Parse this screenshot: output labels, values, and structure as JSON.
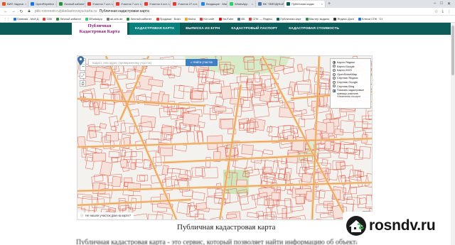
{
  "browser": {
    "tabs": [
      {
        "label": "ВИП Задачи",
        "color": "#e8531a"
      },
      {
        "label": "OpenRepetitor",
        "color": "#1a73e8"
      },
      {
        "label": "Личный кабинет",
        "color": "#2a8f3a"
      },
      {
        "label": "Участок 7 сот. Ц",
        "color": "#e53935"
      },
      {
        "label": "Участок 7 сот. Ц",
        "color": "#e53935"
      },
      {
        "label": "Участок 4 сот. Ц",
        "color": "#e53935"
      },
      {
        "label": "Участок 27 сот.",
        "color": "#e53935"
      },
      {
        "label": "Входящие · Mai",
        "color": "#1e88e5"
      },
      {
        "label": "WhatsApp",
        "color": "#25d366"
      },
      {
        "label": "ВК \"ЗВЁЗДНЫЙ",
        "color": "#4a76a8"
      },
      {
        "label": "Публичная кадас",
        "color": "#0e5c5a",
        "active": true
      }
    ],
    "url_host": "pkk-rosreestr.ru/pkadastrovaya-karta.ru",
    "url_title": "Публичная кадастровая карта",
    "bookmarks": [
      {
        "label": "Главная - Мой Д",
        "color": "#1a73e8"
      },
      {
        "label": "СВК",
        "color": "#e53935"
      },
      {
        "label": "Личный кабинет",
        "color": "#2a8f3a"
      },
      {
        "label": "WhatsApp",
        "color": "#25d366"
      },
      {
        "label": "arl.aris.de",
        "color": "#777777"
      },
      {
        "label": "Личный кабинет",
        "color": "#2a8f3a"
      },
      {
        "label": "Продажа · Бизн",
        "color": "#e53935"
      },
      {
        "label": "Книга",
        "color": "#f5a623"
      },
      {
        "label": "Kro сайт",
        "color": "#e53935"
      },
      {
        "label": "YouTube",
        "color": "#ff0000"
      },
      {
        "label": "ВК",
        "color": "#4a76a8"
      },
      {
        "label": "СПК — Яндекс",
        "color": "#e53935"
      },
      {
        "label": "Публичная карт",
        "color": "#0e5c5a"
      },
      {
        "label": "Мастер выдачи",
        "color": "#2a8f3a"
      },
      {
        "label": "Яндекс Дзен",
        "color": "#333333"
      },
      {
        "label": "Ключи СПК · Ст",
        "color": "#1a73e8"
      }
    ]
  },
  "site": {
    "logo_line1": "Публичная",
    "logo_line2": "Кадастровая Карта",
    "menu": [
      {
        "label": "КАДАСТРОВАЯ КАРТА",
        "active": true
      },
      {
        "label": "ВЫПИСКА ИЗ ЕГРН",
        "active": false
      },
      {
        "label": "КАДАСТРОВЫЙ ПАСПОРТ",
        "active": false
      },
      {
        "label": "КАДАСТРОВАЯ СТОИМОСТЬ",
        "active": false
      }
    ]
  },
  "map": {
    "search_placeholder": "Кадаст. или адрес (проверенному участок)",
    "find_button": "Найти участок",
    "layers": [
      {
        "label": "Карта Яндекс",
        "selected": true
      },
      {
        "label": "Карта Google",
        "selected": false
      },
      {
        "label": "Карта 2GIS",
        "selected": false
      },
      {
        "label": "OpenStreetMap",
        "selected": false
      },
      {
        "label": "Спутник Яндекс",
        "selected": false
      },
      {
        "label": "Спутник Google",
        "selected": false
      },
      {
        "label": "Спутник Bing",
        "selected": false
      }
    ],
    "overlay_option": "Показать кадастровые границы участков",
    "overlay_note": "*Изменения на карте",
    "bottom_note": "Не нашли участок дом на карте?",
    "zoom_in": "+",
    "zoom_out": "−"
  },
  "page": {
    "caption": "Публичная кадастровая карта",
    "body_fragment": "Публичная кадастровая карта - это сервис, который позволяет найти информацию об объектах"
  },
  "watermark": {
    "text": "rosndv.ru",
    "icon": "house-icon"
  },
  "colors": {
    "nav_bg": "#0e5c5a",
    "nav_active": "#0a7f7b",
    "logo_text": "#8a1d7a",
    "find_button": "#3f7fc6",
    "cadastral_lines": "#e0533f"
  }
}
